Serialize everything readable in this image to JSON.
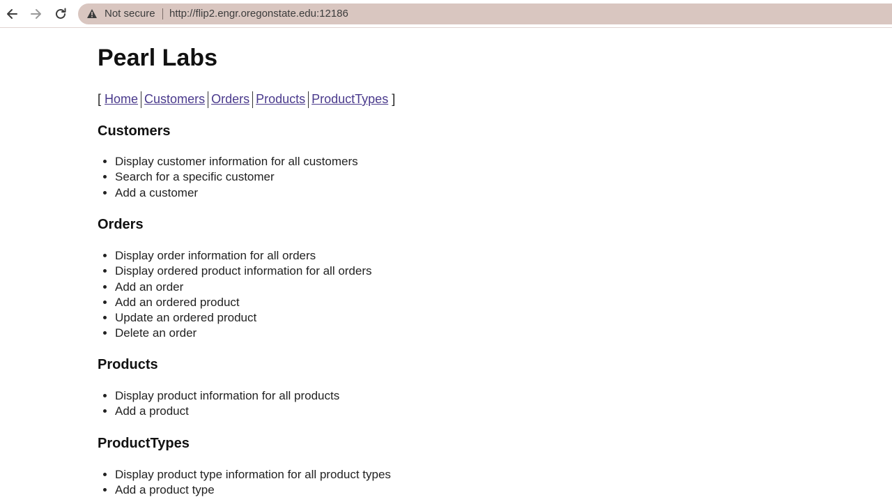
{
  "browser": {
    "security_label": "Not secure",
    "url": "http://flip2.engr.oregonstate.edu:12186"
  },
  "page": {
    "title": "Pearl Labs",
    "nav": {
      "open_bracket": "[",
      "close_bracket": "]",
      "links": [
        "Home",
        "Customers",
        "Orders",
        "Products",
        "ProductTypes"
      ]
    },
    "sections": [
      {
        "heading": "Customers",
        "items": [
          "Display customer information for all customers",
          "Search for a specific customer",
          "Add a customer"
        ]
      },
      {
        "heading": "Orders",
        "items": [
          "Display order information for all orders",
          "Display ordered product information for all orders",
          "Add an order",
          "Add an ordered product",
          "Update an ordered product",
          "Delete an order"
        ]
      },
      {
        "heading": "Products",
        "items": [
          "Display product information for all products",
          "Add a product"
        ]
      },
      {
        "heading": "ProductTypes",
        "items": [
          "Display product type information for all product types",
          "Add a product type"
        ]
      }
    ]
  },
  "icons": [
    "back-arrow-icon",
    "forward-arrow-icon",
    "reload-icon",
    "warning-triangle-icon"
  ]
}
